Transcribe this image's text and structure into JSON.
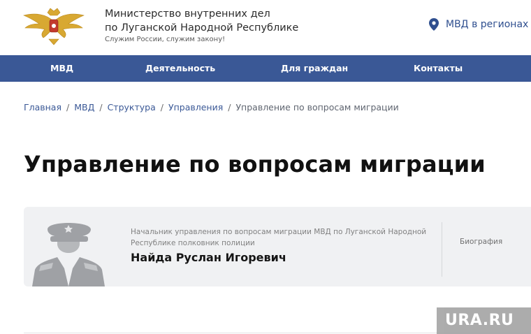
{
  "header": {
    "org_line1": "Министерство внутренних дел",
    "org_line2": "по Луганской Народной Республике",
    "motto": "Служим России, служим закону!",
    "regions_link": "МВД в регионах"
  },
  "nav": {
    "items": [
      {
        "label": "МВД"
      },
      {
        "label": "Деятельность"
      },
      {
        "label": "Для граждан"
      },
      {
        "label": "Контакты"
      }
    ]
  },
  "breadcrumb": {
    "items": [
      {
        "label": "Главная"
      },
      {
        "label": "МВД"
      },
      {
        "label": "Структура"
      },
      {
        "label": "Управления"
      }
    ],
    "separator": "/",
    "current": "Управление по вопросам миграции"
  },
  "page": {
    "title": "Управление по вопросам миграции"
  },
  "person": {
    "position": "Начальник управления по вопросам миграции МВД по Луганской Народной Республике полковник полиции",
    "name": "Найда Руслан Игоревич",
    "bio_link": "Биография"
  },
  "watermark": {
    "text": "URA.RU"
  },
  "colors": {
    "nav_bg": "#3a5896",
    "link": "#3a5896",
    "card_bg": "#f0f1f3",
    "emblem_gold": "#d8a832"
  }
}
